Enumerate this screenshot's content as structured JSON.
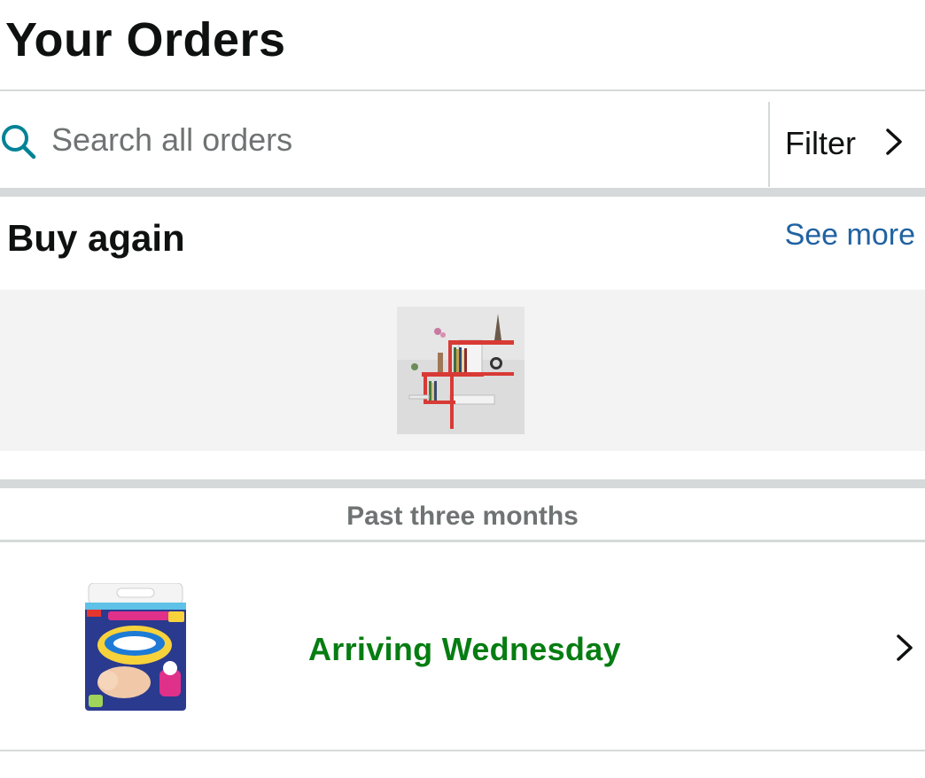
{
  "header": {
    "title": "Your Orders"
  },
  "search": {
    "placeholder": "Search all orders",
    "icon": "search-icon"
  },
  "filter": {
    "label": "Filter",
    "icon": "chevron-right-icon"
  },
  "buy_again": {
    "title": "Buy again",
    "see_more_label": "See more",
    "items": [
      {
        "image": "wall-shelf-product-image"
      }
    ]
  },
  "orders": {
    "period_label": "Past three months",
    "items": [
      {
        "image": "diaper-pack-product-image",
        "status": "Arriving Wednesday",
        "status_color": "#067d12"
      }
    ]
  },
  "colors": {
    "link": "#2162a1",
    "accent": "#008296",
    "success": "#067d12",
    "divider": "#d5d9d9"
  }
}
